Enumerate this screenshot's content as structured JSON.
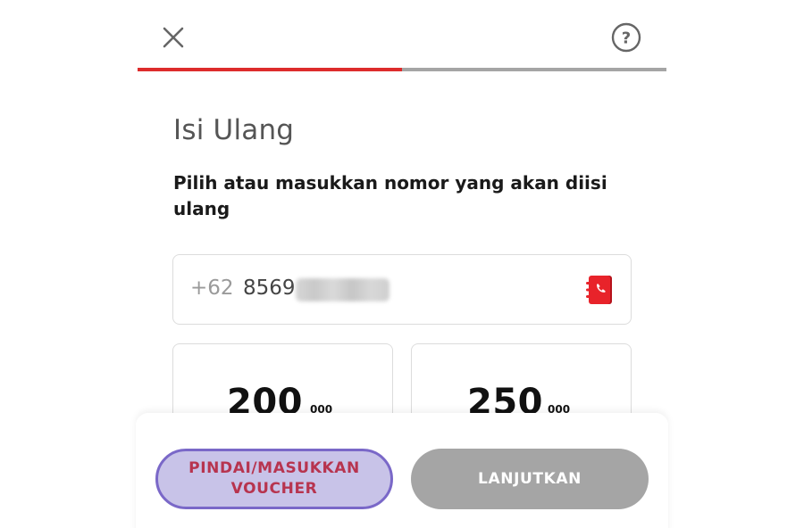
{
  "header": {
    "close_icon": "close-icon",
    "help_icon": "help-circle-icon",
    "help_symbol": "?"
  },
  "progress": {
    "value_fraction": 0.5,
    "fill_color": "#dd2c2c",
    "track_color": "#a5a5a5"
  },
  "page": {
    "title": "Isi Ulang",
    "instruction": "Pilih atau masukkan nomor yang akan diisi ulang"
  },
  "phone": {
    "country_prefix": "+62",
    "number_visible": "8569",
    "number_redacted": true,
    "contact_icon": "phonebook-icon",
    "accent_color": "#e8232a"
  },
  "denominations": [
    {
      "amount": "200",
      "suffix": "000"
    },
    {
      "amount": "250",
      "suffix": "000"
    }
  ],
  "actions": {
    "voucher_label": "PINDAI/MASUKKAN VOUCHER",
    "next_label": "LANJUTKAN"
  }
}
